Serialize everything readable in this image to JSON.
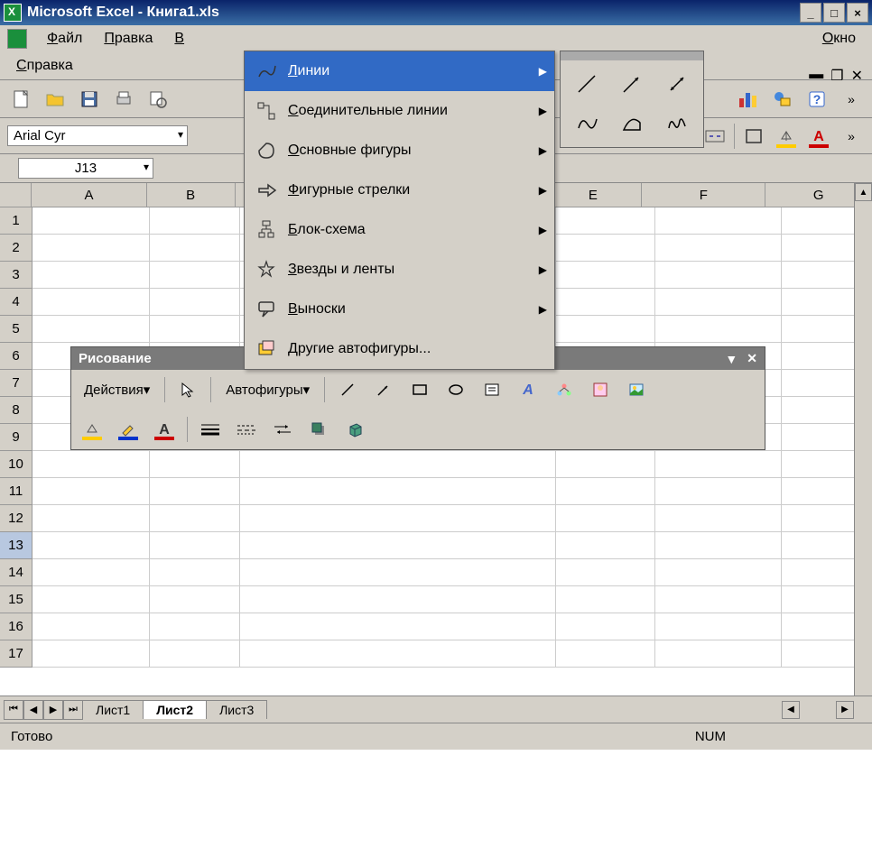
{
  "titlebar": {
    "title": "Microsoft Excel - Книга1.xls"
  },
  "menubar": {
    "items": [
      {
        "label": "Файл",
        "u": "Ф"
      },
      {
        "label": "Правка",
        "u": "П"
      },
      {
        "label": "В",
        "u": "В"
      },
      {
        "label": "Окно",
        "u": "О"
      },
      {
        "label": "Справка",
        "u": "С"
      }
    ]
  },
  "fontbox": {
    "font": "Arial Cyr"
  },
  "namebox": {
    "ref": "J13"
  },
  "columns": [
    "A",
    "B",
    "E",
    "F",
    "G"
  ],
  "rows": [
    "1",
    "2",
    "3",
    "4",
    "5",
    "6",
    "7",
    "8",
    "9",
    "10",
    "11",
    "12",
    "13",
    "14",
    "15",
    "16",
    "17"
  ],
  "selected_row": "13",
  "autoshapes_menu": {
    "items": [
      {
        "label": "Линии",
        "icon": "lines-icon",
        "highlighted": true,
        "submenu": true
      },
      {
        "label": "Соединительные линии",
        "icon": "connectors-icon",
        "submenu": true
      },
      {
        "label": "Основные фигуры",
        "icon": "basic-shapes-icon",
        "submenu": true
      },
      {
        "label": "Фигурные стрелки",
        "icon": "block-arrows-icon",
        "submenu": true
      },
      {
        "label": "Блок-схема",
        "icon": "flowchart-icon",
        "submenu": true
      },
      {
        "label": "Звезды и ленты",
        "icon": "stars-icon",
        "submenu": true
      },
      {
        "label": "Выноски",
        "icon": "callouts-icon",
        "submenu": true
      },
      {
        "label": "Другие автофигуры...",
        "icon": "more-shapes-icon",
        "submenu": false
      }
    ]
  },
  "lines_flyout": {
    "options": [
      "line",
      "arrow",
      "double-arrow",
      "curve",
      "freeform",
      "scribble"
    ]
  },
  "drawing_toolbar": {
    "title": "Рисование",
    "actions_label": "Действия",
    "autoshapes_label": "Автофигуры"
  },
  "sheet_tabs": {
    "tabs": [
      "Лист1",
      "Лист2",
      "Лист3"
    ],
    "active": "Лист2"
  },
  "statusbar": {
    "ready": "Готово",
    "num": "NUM"
  }
}
